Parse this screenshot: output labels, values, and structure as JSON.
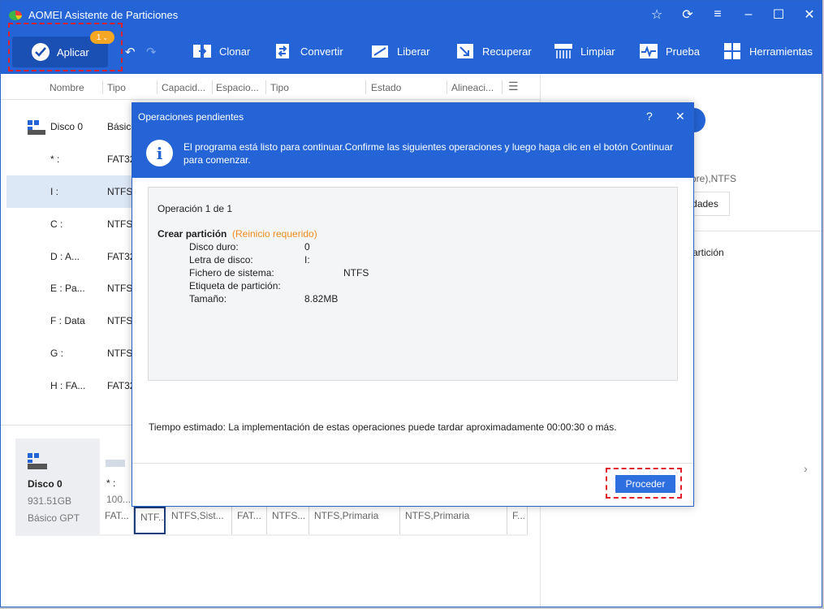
{
  "app": {
    "title": "AOMEI Asistente de Particiones"
  },
  "toolbar": {
    "apply_label": "Aplicar",
    "pending_count": "1",
    "tools": [
      {
        "label": "Clonar",
        "icon": "clone-icon"
      },
      {
        "label": "Convertir",
        "icon": "convert-icon"
      },
      {
        "label": "Liberar",
        "icon": "free-icon"
      },
      {
        "label": "Recuperar",
        "icon": "recover-icon"
      },
      {
        "label": "Limpiar",
        "icon": "wipe-icon"
      },
      {
        "label": "Prueba",
        "icon": "test-icon"
      },
      {
        "label": "Herramientas",
        "icon": "tools-icon"
      }
    ]
  },
  "columns": [
    "Nombre",
    "Tipo",
    "Capacid...",
    "Espacio...",
    "Tipo",
    "Estado",
    "Alineaci..."
  ],
  "partitions": [
    {
      "name": "Disco 0",
      "type": "Básico"
    },
    {
      "name": "* :",
      "type": "FAT32"
    },
    {
      "name": "I :",
      "type": "NTFS"
    },
    {
      "name": "C :",
      "type": "NTFS"
    },
    {
      "name": "D : A...",
      "type": "FAT32"
    },
    {
      "name": "E : Pa...",
      "type": "NTFS"
    },
    {
      "name": "F : Data",
      "type": "NTFS"
    },
    {
      "name": "G :",
      "type": "NTFS"
    },
    {
      "name": "H : FA...",
      "type": "FAT32"
    }
  ],
  "diskmap": {
    "disk_name": "Disco 0",
    "disk_size": "931.51GB",
    "disk_kind": "Básico GPT",
    "first_label": "* :",
    "first_size": "100...",
    "segments": [
      "FAT...",
      "NTF...",
      "NTFS,Sist...",
      "FAT...",
      "NTFS...",
      "NTFS,Primaria",
      "NTFS,Primaria",
      "F..."
    ]
  },
  "right": {
    "fs_text": "bre),NTFS",
    "prop_btn": "dades",
    "action": "artición"
  },
  "dialog": {
    "title": "Operaciones pendientes",
    "help": "?",
    "info": "El programa está listo para continuar.Confirme las siguientes operaciones y luego haga clic en el botón Continuar para comenzar.",
    "op_header": "Operación 1 de 1",
    "op_name": "Crear partición",
    "op_note": "(Reinicio requerido)",
    "fields": [
      {
        "k": "Disco duro:",
        "v": "0"
      },
      {
        "k": "Letra de disco:",
        "v": "I:"
      },
      {
        "k": "Fichero de sistema:",
        "v": "NTFS"
      },
      {
        "k": "Etiqueta de partición:",
        "v": ""
      },
      {
        "k": "Tamaño:",
        "v": "8.82MB"
      }
    ],
    "estimate": "Tiempo estimado: La implementación de estas operaciones puede tardar aproximadamente 00:00:30 o más.",
    "proceed": "Proceder"
  },
  "colors": {
    "accent": "#2464d6",
    "warning": "#f5a623",
    "highlight": "#e0202a"
  }
}
